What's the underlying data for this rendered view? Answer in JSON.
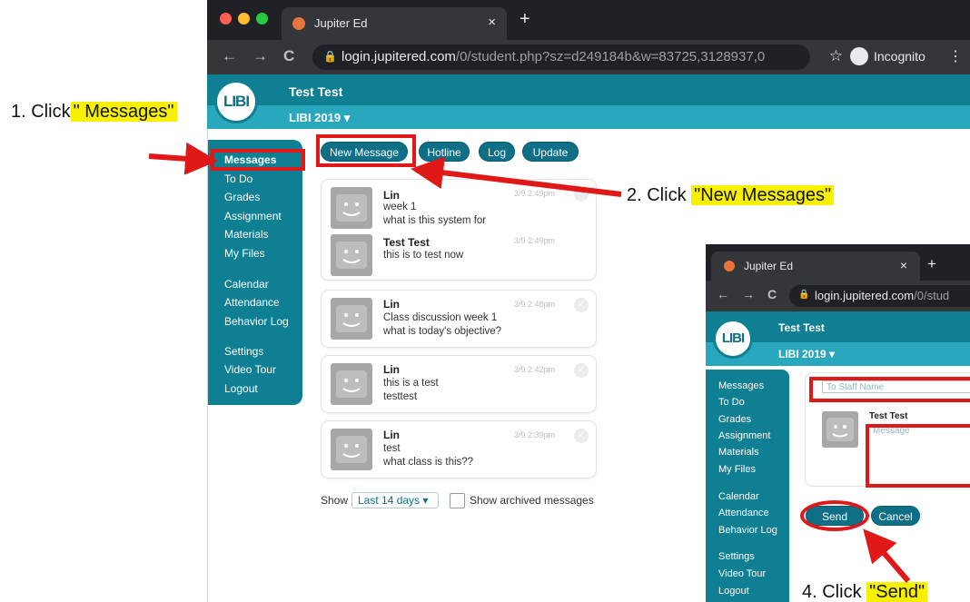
{
  "browser": {
    "tab_title": "Jupiter Ed",
    "tab_close": "×",
    "new_tab": "+",
    "back": "←",
    "forward": "→",
    "reload": "C",
    "url_host": "login.jupitered.com",
    "url_rest": "/0/student.php?sz=d249184b&w=83725,3128937,0",
    "profile": "Incognito",
    "colors": {
      "frame": "#202124",
      "toolbar": "#35363a"
    }
  },
  "app": {
    "logo": "LIBI",
    "user_name": "Test Test",
    "term": "LIBI 2019",
    "term_caret": "▾",
    "colors": {
      "primary": "#0f7f94",
      "band": "#28a7bd"
    }
  },
  "sidebar": {
    "groups": [
      [
        "Messages",
        "To Do",
        "Grades",
        "Assignment",
        "Materials",
        "My Files"
      ],
      [
        "Calendar",
        "Attendance",
        "Behavior Log"
      ],
      [
        "Settings",
        "Video Tour",
        "Logout"
      ]
    ]
  },
  "actions": [
    "New Message",
    "Hotline",
    "Log",
    "Update"
  ],
  "threads": [
    {
      "messages": [
        {
          "sender": "Lin",
          "lines": [
            "week 1",
            "what is this system for"
          ],
          "time": "3/9 2:49pm"
        },
        {
          "sender": "Test Test",
          "lines": [
            "this is to test now"
          ],
          "time": "3/9 2:49pm"
        }
      ]
    },
    {
      "messages": [
        {
          "sender": "Lin",
          "lines": [
            "Class discussion week 1",
            "what is today's objective?"
          ],
          "time": "3/9 2:48pm"
        }
      ]
    },
    {
      "messages": [
        {
          "sender": "Lin",
          "lines": [
            "this is a test",
            "testtest"
          ],
          "time": "3/9 2:42pm"
        }
      ]
    },
    {
      "messages": [
        {
          "sender": "Lin",
          "lines": [
            "test",
            "what class is this??"
          ],
          "time": "3/9 2:39pm"
        }
      ]
    }
  ],
  "filter": {
    "show_label": "Show",
    "range": "Last 14 days",
    "archived_label": "Show archived messages"
  },
  "annotations": {
    "step1_prefix": "1. Click",
    "step1_highlight": "\" Messages\"",
    "step2_prefix": "2. Click",
    "step2_highlight": "\"New Messages\"",
    "step4_prefix": "4. Click",
    "step4_highlight": "\"Send\"",
    "highlight_color": "#f7f100",
    "arrow_color": "#e01818"
  },
  "compose": {
    "tab_title": "Jupiter Ed",
    "url_host": "login.jupitered.com",
    "url_rest": "/0/stud",
    "user_name": "Test Test",
    "term": "LIBI 2019",
    "to_placeholder": "To Staff Name",
    "sender": "Test Test",
    "message_placeholder": "Message",
    "send": "Send",
    "cancel": "Cancel",
    "sidebar": [
      [
        "Messages",
        "To Do",
        "Grades",
        "Assignment",
        "Materials",
        "My Files"
      ],
      [
        "Calendar",
        "Attendance",
        "Behavior Log"
      ],
      [
        "Settings",
        "Video Tour",
        "Logout"
      ]
    ]
  }
}
